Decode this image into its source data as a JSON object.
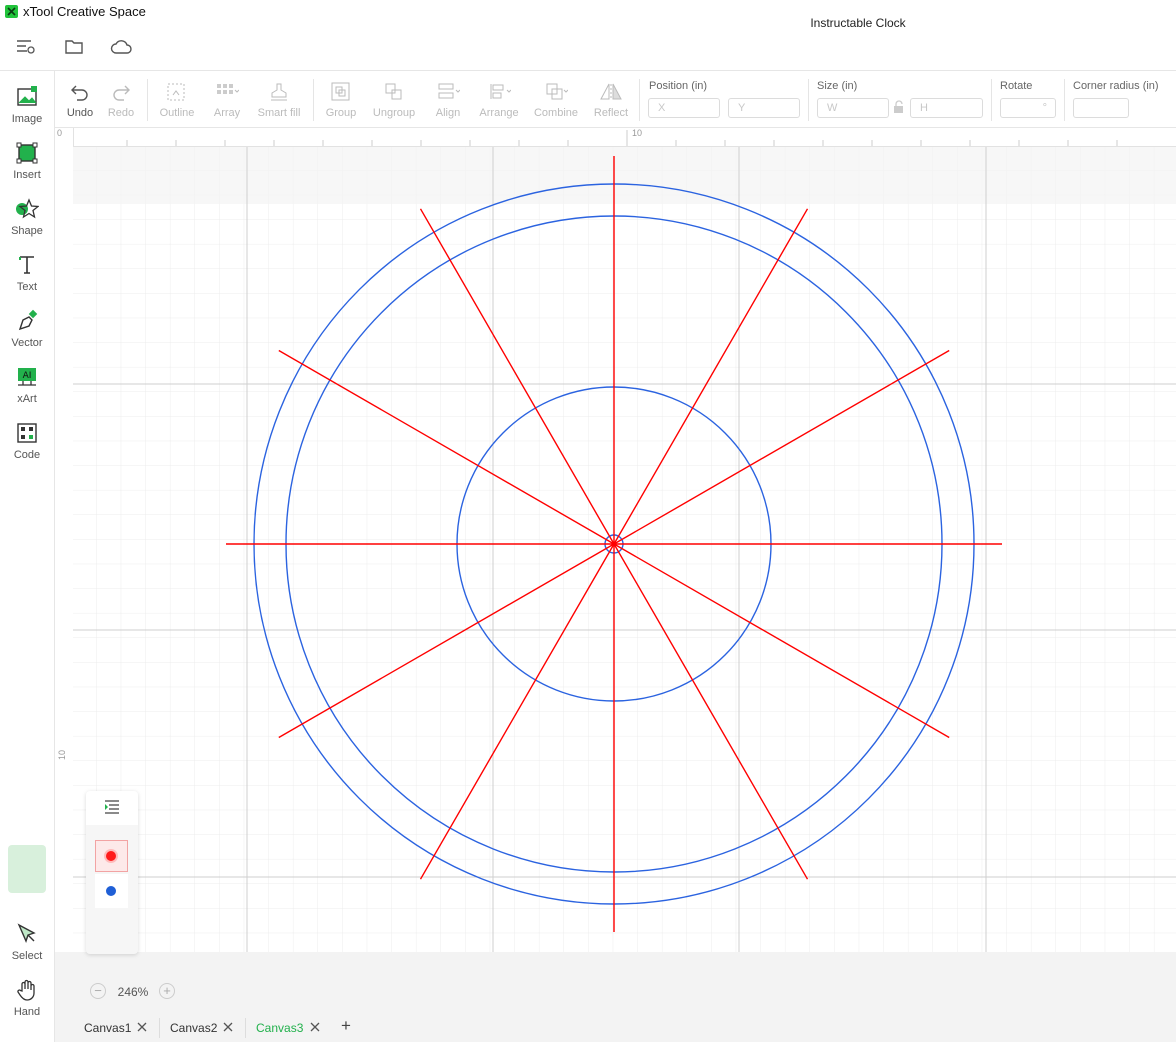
{
  "app": {
    "title": "xTool Creative Space",
    "logo_color": "#22c33b"
  },
  "header": {
    "document_title": "Instructable Clock",
    "icons": [
      "menu-settings-icon",
      "folder-icon",
      "cloud-icon"
    ]
  },
  "sidebar": {
    "tools": [
      {
        "id": "image",
        "label": "Image",
        "icon": "image-icon"
      },
      {
        "id": "insert",
        "label": "Insert",
        "icon": "insert-icon"
      },
      {
        "id": "shape",
        "label": "Shape",
        "icon": "shape-icon"
      },
      {
        "id": "text",
        "label": "Text",
        "icon": "text-icon"
      },
      {
        "id": "vector",
        "label": "Vector",
        "icon": "pen-icon"
      },
      {
        "id": "xart",
        "label": "xArt",
        "icon": "ai-icon"
      },
      {
        "id": "code",
        "label": "Code",
        "icon": "qrcode-icon"
      },
      {
        "id": "select",
        "label": "Select",
        "icon": "cursor-icon",
        "active": true
      },
      {
        "id": "hand",
        "label": "Hand",
        "icon": "hand-icon"
      }
    ],
    "accent": "#22b14c"
  },
  "toolbar": {
    "undo": "Undo",
    "redo": "Redo",
    "outline": "Outline",
    "array": "Array",
    "smart_fill": "Smart fill",
    "group": "Group",
    "ungroup": "Ungroup",
    "align": "Align",
    "arrange": "Arrange",
    "combine": "Combine",
    "reflect": "Reflect",
    "position_label": "Position (in)",
    "x_placeholder": "X",
    "y_placeholder": "Y",
    "size_label": "Size (in)",
    "w_placeholder": "W",
    "h_placeholder": "H",
    "rotate_label": "Rotate",
    "rotate_unit": "°",
    "corner_label": "Corner radius (in)"
  },
  "rulers": {
    "top_mark": "10",
    "left_top_mark": "0",
    "left_mark": "10"
  },
  "canvas": {
    "shapes": {
      "circles": [
        {
          "role": "outer-ring",
          "color": "#2b63e0"
        },
        {
          "role": "inner-ring",
          "color": "#2b63e0"
        },
        {
          "role": "center-disc",
          "color": "#2b63e0"
        },
        {
          "role": "center-hole",
          "color": "#2b63e0"
        }
      ],
      "spoke_count": 12,
      "spoke_color": "#ff0000"
    }
  },
  "zoom": {
    "value": "246%",
    "minus": "−",
    "plus": "+"
  },
  "layers": [
    {
      "color": "#ff1a1a",
      "selected": true
    },
    {
      "color": "#1f5fd6",
      "selected": false
    }
  ],
  "tabs": [
    {
      "label": "Canvas1",
      "active": false
    },
    {
      "label": "Canvas2",
      "active": false
    },
    {
      "label": "Canvas3",
      "active": true
    }
  ],
  "tab_add": "+"
}
